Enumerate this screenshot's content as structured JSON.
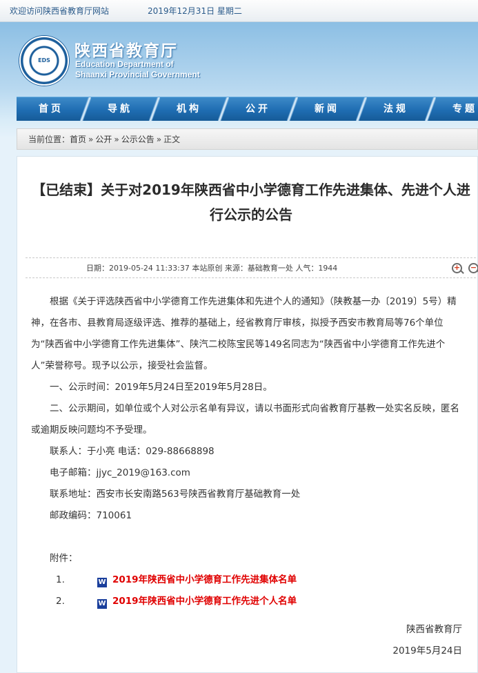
{
  "topbar": {
    "welcome": "欢迎访问陕西省教育厅网站",
    "date": "2019年12月31日  星期二"
  },
  "header": {
    "emblem_text": "EDS",
    "title_cn": "陕西省教育厅",
    "title_en_1": "Education Department of",
    "title_en_2": "Shaanxi Provincial Government"
  },
  "nav": {
    "items": [
      "首页",
      "导航",
      "机构",
      "公开",
      "新闻",
      "法规",
      "专题"
    ]
  },
  "breadcrumb": {
    "prefix": "当前位置：",
    "items": [
      "首页",
      "公开",
      "公示公告",
      "正文"
    ],
    "separator": "»"
  },
  "article": {
    "title": "【已结束】关于对2019年陕西省中小学德育工作先进集体、先进个人进行公示的公告",
    "meta": "日期：2019-05-24 11:33:37    本站原创  来源：基础教育一处    人气：1944",
    "paragraphs": [
      "根据《关于评选陕西省中小学德育工作先进集体和先进个人的通知》（陕教基一办〔2019〕5号）精神，在各市、县教育局逐级评选、推荐的基础上，经省教育厅审核，拟授予西安市教育局等76个单位为“陕西省中小学德育工作先进集体”、陕汽二校陈宝民等149名同志为“陕西省中小学德育工作先进个人”荣誉称号。现予以公示，接受社会监督。",
      "一、公示时间：2019年5月24日至2019年5月28日。",
      "二、公示期间，如单位或个人对公示名单有异议，请以书面形式向省教育厅基教一处实名反映，匿名或逾期反映问题均不予受理。",
      "联系人：于小亮    电话：029-88668898",
      "电子邮箱：jjyc_2019@163.com",
      "联系地址：西安市长安南路563号陕西省教育厅基础教育一处",
      "邮政编码：710061"
    ],
    "attachment_label": "附件：",
    "attachments": [
      {
        "num": "1.",
        "label": "2019年陕西省中小学德育工作先进集体名单"
      },
      {
        "num": "2.",
        "label": "2019年陕西省中小学德育工作先进个人名单"
      }
    ],
    "signature": "陕西省教育厅",
    "sign_date": "2019年5月24日"
  }
}
